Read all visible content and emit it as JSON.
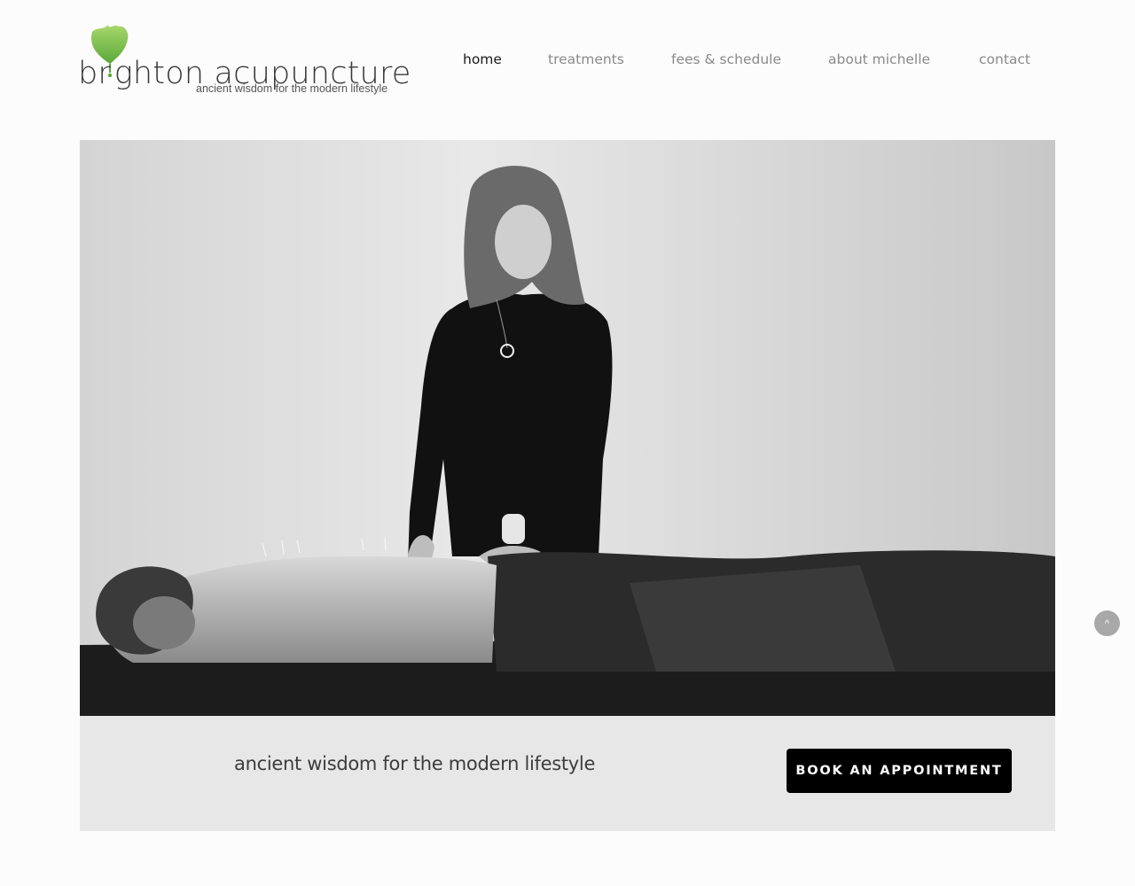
{
  "logo": {
    "name_part1": "br",
    "name_part2": "ghton acupuncture",
    "tagline": "ancient wisdom for the modern lifestyle",
    "leaf_color": "#7dc24b"
  },
  "nav": {
    "items": [
      {
        "label": "home",
        "active": true
      },
      {
        "label": "treatments",
        "active": false
      },
      {
        "label": "fees & schedule",
        "active": false
      },
      {
        "label": "about michelle",
        "active": false
      },
      {
        "label": "contact",
        "active": false
      }
    ]
  },
  "hero": {
    "image_icon": "acupuncture-photo"
  },
  "banner": {
    "text": "ancient wisdom for the modern lifestyle",
    "button_label": "BOOK AN APPOINTMENT"
  },
  "back_to_top": {
    "icon": "chevron-up-icon",
    "glyph": "^"
  }
}
